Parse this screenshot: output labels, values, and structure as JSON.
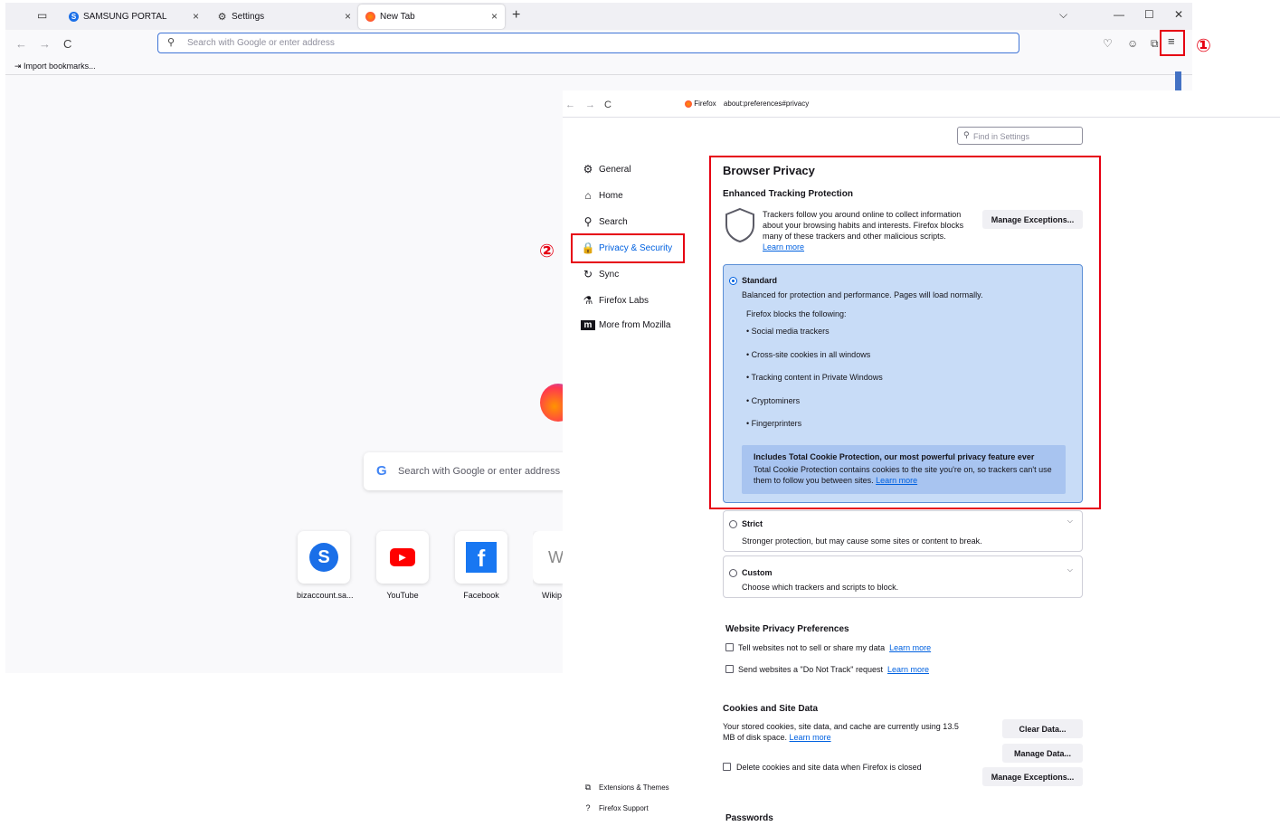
{
  "browser": {
    "tabs": [
      {
        "label": "SAMSUNG PORTAL",
        "close": "×"
      },
      {
        "label": "Settings",
        "close": "×"
      },
      {
        "label": "New Tab",
        "close": "×"
      }
    ],
    "new_tab_button": "+",
    "window_controls": {
      "list": "⌵",
      "minimize": "—",
      "maximize": "☐",
      "close": "✕"
    },
    "nav": {
      "back": "←",
      "forward": "→",
      "reload": "C"
    },
    "urlbar": {
      "placeholder": "Search with Google or enter address"
    },
    "bookmarks_bar": {
      "import": "Import bookmarks..."
    },
    "menu_icon": "≡",
    "step1": "①"
  },
  "newtab": {
    "search_placeholder": "Search with Google or enter address",
    "google_glyph": "G",
    "tiles": [
      {
        "label": "bizaccount.sa...",
        "glyph": "S",
        "color": "#1a6fe8"
      },
      {
        "label": "YouTube",
        "glyph": "▶",
        "color": "#ff0000"
      },
      {
        "label": "Facebook",
        "glyph": "f",
        "color": "#1877f2"
      },
      {
        "label": "Wikip",
        "glyph": "W",
        "color": "#888888"
      }
    ]
  },
  "settings": {
    "nav": {
      "back": "←",
      "forward": "→",
      "reload": "C"
    },
    "url": {
      "site": "Firefox",
      "path": "about:preferences#privacy"
    },
    "find_placeholder": "Find in Settings",
    "sidebar": [
      {
        "label": "General",
        "icon": "⚙"
      },
      {
        "label": "Home",
        "icon": "⌂"
      },
      {
        "label": "Search",
        "icon": "⚲"
      },
      {
        "label": "Privacy & Security",
        "icon": "🔒"
      },
      {
        "label": "Sync",
        "icon": "↻"
      },
      {
        "label": "Firefox Labs",
        "icon": "⚗"
      },
      {
        "label": "More from Mozilla",
        "icon": "m"
      }
    ],
    "sidebar_bottom": [
      {
        "label": "Extensions & Themes",
        "icon": "⧉"
      },
      {
        "label": "Firefox Support",
        "icon": "?"
      }
    ],
    "step2": "②",
    "privacy": {
      "title": "Browser Privacy",
      "etp_title": "Enhanced Tracking Protection",
      "etp_desc": "Trackers follow you around online to collect information about your browsing habits and interests. Firefox blocks many of these trackers and other malicious scripts.",
      "learn_more": "Learn more",
      "manage_exceptions": "Manage Exceptions...",
      "standard": {
        "label": "Standard",
        "desc": "Balanced for protection and performance. Pages will load normally.",
        "blocks_title": "Firefox blocks the following:",
        "blocks": [
          "• Social media trackers",
          "• Cross-site cookies in all windows",
          "• Tracking content in Private Windows",
          "• Cryptominers",
          "• Fingerprinters"
        ],
        "tcp_title": "Includes Total Cookie Protection, our most powerful privacy feature ever",
        "tcp_desc": "Total Cookie Protection contains cookies to the site you're on, so trackers can't use them to follow you between sites.",
        "tcp_link": "Learn more"
      },
      "strict": {
        "label": "Strict",
        "desc": "Stronger protection, but may cause some sites or content to break."
      },
      "custom": {
        "label": "Custom",
        "desc": "Choose which trackers and scripts to block."
      }
    },
    "website_privacy": {
      "title": "Website Privacy Preferences",
      "tell": "Tell websites not to sell or share my data",
      "dnt": "Send websites a \"Do Not Track\" request",
      "learn_more": "Learn more"
    },
    "cookies": {
      "title": "Cookies and Site Data",
      "desc": "Your stored cookies, site data, and cache are currently using 13.5 MB of disk space.",
      "learn_more": "Learn more",
      "clear": "Clear Data...",
      "manage": "Manage Data...",
      "exceptions": "Manage Exceptions...",
      "delete_on_close": "Delete cookies and site data when Firefox is closed"
    },
    "passwords_title": "Passwords"
  },
  "colors": {
    "highlight": "#e60012",
    "arrow": "#4472c4",
    "accent": "#0061e0"
  }
}
